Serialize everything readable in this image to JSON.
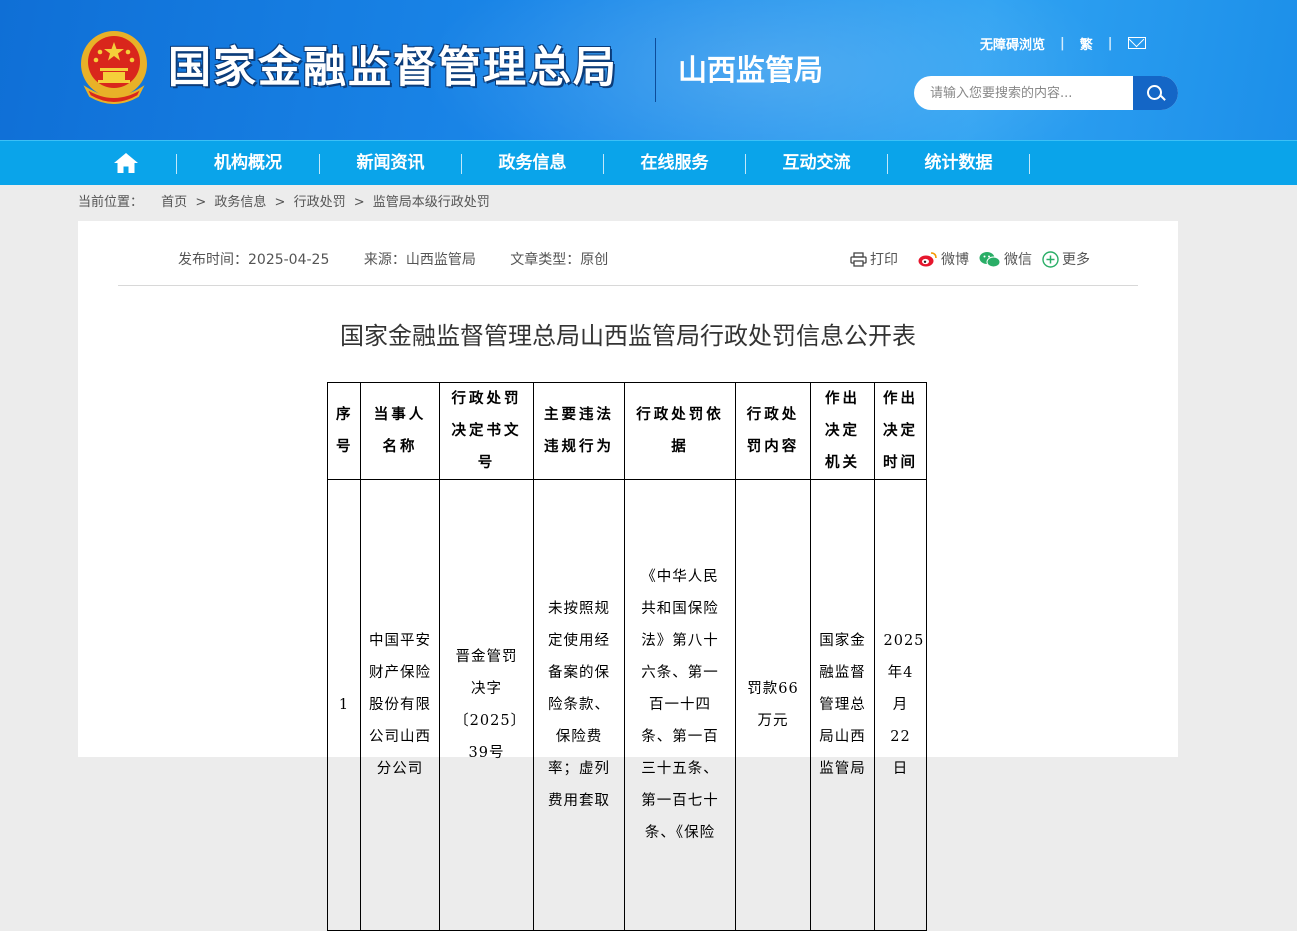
{
  "header": {
    "title": "国家金融监督管理总局",
    "subtitle": "山西监管局",
    "links": [
      "无障碍浏览",
      "繁"
    ],
    "search": {
      "placeholder": "请输入您要搜索的内容..."
    }
  },
  "nav": {
    "items": [
      "机构概况",
      "新闻资讯",
      "政务信息",
      "在线服务",
      "互动交流",
      "统计数据"
    ]
  },
  "breadcrumb": {
    "label": "当前位置：",
    "items": [
      "首页",
      ">",
      "政务信息",
      ">",
      "行政处罚",
      ">",
      "监管局本级行政处罚"
    ]
  },
  "article": {
    "publish_time": "发布时间：2025-04-25",
    "source": "来源：山西监管局",
    "type": "文章类型：原创",
    "share": {
      "print": "打印",
      "weibo": "微博",
      "weixin": "微信",
      "more": "更多"
    },
    "title": "国家金融监督管理总局山西监管局行政处罚信息公开表"
  },
  "table": {
    "headers": [
      "序号",
      "当事人名称",
      "行政处罚决定书文号",
      "主要违法违规行为",
      "行政处罚依据",
      "行政处罚内容",
      "作出决定机关",
      "作出决定时间"
    ],
    "row": {
      "index": "1",
      "party": "中国平安财产保险股份有限公司山西分公司",
      "doc_no": "晋金管罚决字〔2025〕39号",
      "violation": "未按照规定使用经备案的保险条款、保险费率；虚列费用套取",
      "basis": "《中华人民共和国保险法》第八十六条、第一百一十四条、第一百三十五条、第一百七十条、《保险",
      "penalty": "罚款66万元",
      "authority": "国家金融监督管理总局山西监管局",
      "date": "2025年4月22日"
    }
  }
}
